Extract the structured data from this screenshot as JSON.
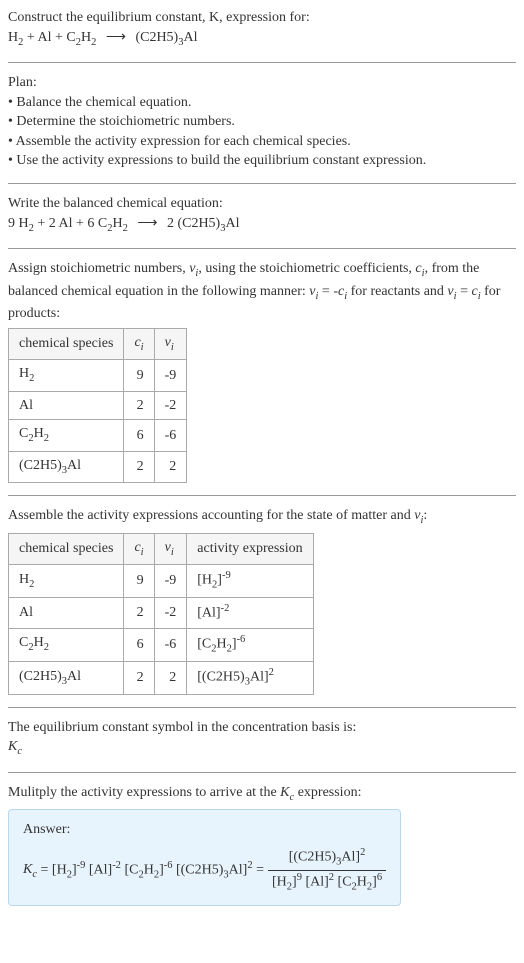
{
  "intro": {
    "line1": "Construct the equilibrium constant, K, expression for:",
    "equation": "H₂ + Al + C₂H₂  ⟶  (C2H5)₃Al"
  },
  "plan": {
    "title": "Plan:",
    "bullet1": "• Balance the chemical equation.",
    "bullet2": "• Determine the stoichiometric numbers.",
    "bullet3": "• Assemble the activity expression for each chemical species.",
    "bullet4": "• Use the activity expressions to build the equilibrium constant expression."
  },
  "balanced": {
    "title": "Write the balanced chemical equation:",
    "equation": "9 H₂ + 2 Al + 6 C₂H₂  ⟶  2 (C2H5)₃Al"
  },
  "assign": {
    "text": "Assign stoichiometric numbers, νᵢ, using the stoichiometric coefficients, cᵢ, from the balanced chemical equation in the following manner: νᵢ = -cᵢ for reactants and νᵢ = cᵢ for products:"
  },
  "table1": {
    "headers": [
      "chemical species",
      "cᵢ",
      "νᵢ"
    ],
    "rows": [
      {
        "species": "H₂",
        "c": "9",
        "v": "-9"
      },
      {
        "species": "Al",
        "c": "2",
        "v": "-2"
      },
      {
        "species": "C₂H₂",
        "c": "6",
        "v": "-6"
      },
      {
        "species": "(C2H5)₃Al",
        "c": "2",
        "v": "2"
      }
    ]
  },
  "assemble": {
    "text": "Assemble the activity expressions accounting for the state of matter and νᵢ:"
  },
  "table2": {
    "headers": [
      "chemical species",
      "cᵢ",
      "νᵢ",
      "activity expression"
    ],
    "rows": [
      {
        "species": "H₂",
        "c": "9",
        "v": "-9",
        "expr": "[H₂]⁻⁹"
      },
      {
        "species": "Al",
        "c": "2",
        "v": "-2",
        "expr": "[Al]⁻²"
      },
      {
        "species": "C₂H₂",
        "c": "6",
        "v": "-6",
        "expr": "[C₂H₂]⁻⁶"
      },
      {
        "species": "(C2H5)₃Al",
        "c": "2",
        "v": "2",
        "expr": "[(C2H5)₃Al]²"
      }
    ]
  },
  "symbol": {
    "line1": "The equilibrium constant symbol in the concentration basis is:",
    "line2": "K꜀"
  },
  "multiply": {
    "text": "Mulitply the activity expressions to arrive at the K꜀ expression:"
  },
  "answer": {
    "label": "Answer:",
    "lhs": "K꜀ = [H₂]⁻⁹ [Al]⁻² [C₂H₂]⁻⁶ [(C2H5)₃Al]² =",
    "numerator": "[(C2H5)₃Al]²",
    "denominator": "[H₂]⁹ [Al]² [C₂H₂]⁶"
  }
}
